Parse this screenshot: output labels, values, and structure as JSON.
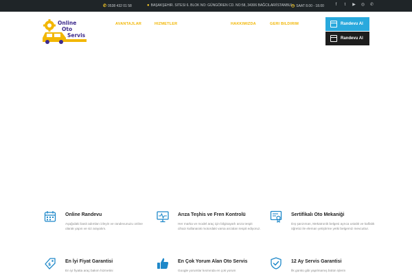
{
  "topbar": {
    "phone": "0538 432 01 58",
    "address": "BAŞAKŞEHIR. SITESI 6. BLOK NO: GÜNGÖREN CD. NO:58, 34306 BAĞCILAR/İSTANBUL",
    "hours": "SAAT 8.00 - 18.00",
    "social": [
      {
        "icon": "facebook-icon",
        "glyph": "f"
      },
      {
        "icon": "twitter-icon",
        "glyph": "t"
      },
      {
        "icon": "youtube-icon",
        "glyph": "▶"
      },
      {
        "icon": "instagram-icon",
        "glyph": "◎"
      },
      {
        "icon": "whatsapp-icon",
        "glyph": "✆"
      }
    ]
  },
  "logo": {
    "line1": "Online",
    "line2": "Oto",
    "line3": "Servis"
  },
  "nav": {
    "items": [
      "AVANTAJLAR",
      "HIZMETLER",
      "HAKKIMIZDA",
      "GERI BILDIRIM"
    ]
  },
  "buttons": {
    "randevu_primary": "Randevu Al",
    "randevu_secondary": "Randevu Al"
  },
  "colors": {
    "accent": "#f2b705",
    "topbar_bg": "#1f2528",
    "button_blue": "#29a9dd",
    "icon_blue": "#1e88c9"
  },
  "features": [
    {
      "title": "Online Randevu",
      "text": "Aşağıdaki basit adımları izleyin ve randevunuzu online olarak yapın ve siz arayalım.",
      "icon": "calendar-icon"
    },
    {
      "title": "Arıza Teşhis ve Fren Kontrolü",
      "text": "Her marka ve model araç için bilgisayarlı arıza tespit cihazı kullanarak motordaki varsa arızaları tespit ediyoruz.",
      "icon": "monitor-diagnostics-icon"
    },
    {
      "title": "Sertifikalı Oto Mekaniği",
      "text": "Dış şanzıman, Mekatronik belgesi ayrıca ustalık ve kalfalık öğretici ile eleman yetiştirme yetki belgemiz mevcuttur.",
      "icon": "certificate-icon"
    },
    {
      "title": "En İyi Fiyat Garantisi",
      "text": "En iyi fiyatta araç bakım hizmetini",
      "icon": "price-tag-icon"
    },
    {
      "title": "En Çok Yorum Alan Oto Servis",
      "text": "Google yorumlar kısmında en çok yorum",
      "icon": "thumbs-up-icon"
    },
    {
      "title": "12 Ay Servis Garantisi",
      "text": "İlk günkü gibi yapılmamış bütün işlerin",
      "icon": "shield-check-icon"
    }
  ]
}
